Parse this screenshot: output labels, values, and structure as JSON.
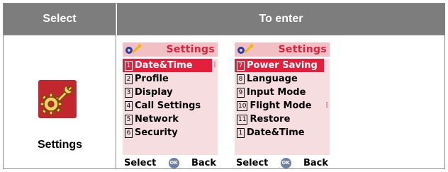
{
  "header": {
    "col1": "Select",
    "col2": "To enter"
  },
  "left": {
    "icon": "settings-wrench-gear-icon",
    "label": "Settings"
  },
  "phones": [
    {
      "title": "Settings",
      "items": [
        {
          "num": "1",
          "label": "Date&Time",
          "selected": true
        },
        {
          "num": "2",
          "label": "Profile",
          "selected": false
        },
        {
          "num": "3",
          "label": "Display",
          "selected": false
        },
        {
          "num": "4",
          "label": "Call Settings",
          "selected": false
        },
        {
          "num": "5",
          "label": "Network",
          "selected": false
        },
        {
          "num": "6",
          "label": "Security",
          "selected": false
        }
      ],
      "softkeys": {
        "left": "Select",
        "center": "OK",
        "right": "Back"
      }
    },
    {
      "title": "Settings",
      "items": [
        {
          "num": "7",
          "label": "Power Saving",
          "selected": true
        },
        {
          "num": "8",
          "label": "Language",
          "selected": false
        },
        {
          "num": "9",
          "label": "Input Mode",
          "selected": false
        },
        {
          "num": "10",
          "label": "Flight Mode",
          "selected": false
        },
        {
          "num": "11",
          "label": "Restore",
          "selected": false
        },
        {
          "num": "1",
          "label": "Date&Time",
          "selected": false
        }
      ],
      "softkeys": {
        "left": "Select",
        "center": "OK",
        "right": "Back"
      }
    }
  ],
  "colors": {
    "header_bg": "#7d7d7d",
    "accent": "#e31f3b",
    "menu_bg": "#f6dde0",
    "titlebar_bg": "#f1c0c5"
  }
}
